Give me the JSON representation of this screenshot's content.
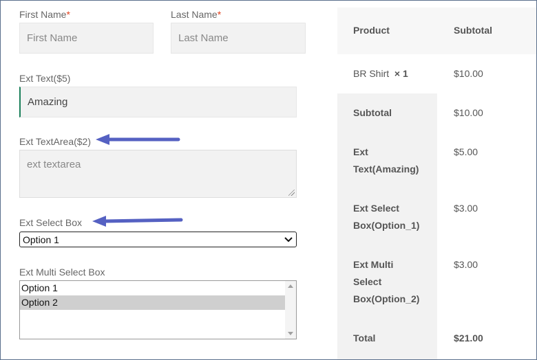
{
  "form": {
    "first_name": {
      "label": "First Name",
      "required_mark": "*",
      "placeholder": "First Name"
    },
    "last_name": {
      "label": "Last Name",
      "required_mark": "*",
      "placeholder": "Last Name"
    },
    "ext_text": {
      "label": "Ext Text($5)",
      "value": "Amazing"
    },
    "ext_textarea": {
      "label": "Ext TextArea($2)",
      "placeholder": "ext textarea"
    },
    "ext_select": {
      "label": "Ext Select Box",
      "value": "Option 1"
    },
    "ext_multi": {
      "label": "Ext Multi Select Box",
      "options": [
        {
          "label": "Option 1",
          "selected": false
        },
        {
          "label": "Option 2",
          "selected": true
        }
      ]
    }
  },
  "order_summary": {
    "header": {
      "product": "Product",
      "subtotal": "Subtotal"
    },
    "item": {
      "name": "BR Shirt",
      "qty": "× 1",
      "price": "$10.00"
    },
    "rows": [
      {
        "label": "Subtotal",
        "value": "$10.00"
      },
      {
        "label_lines": [
          "Ext",
          "Text(Amazing)"
        ],
        "value": "$5.00"
      },
      {
        "label_lines": [
          "Ext Select",
          "Box(Option_1)"
        ],
        "value": "$3.00"
      },
      {
        "label_lines": [
          "Ext Multi",
          "Select",
          "Box(Option_2)"
        ],
        "value": "$3.00"
      }
    ],
    "total": {
      "label": "Total",
      "value": "$21.00"
    }
  },
  "colors": {
    "arrow": "#5561c2",
    "required": "#e2401c",
    "focus_border": "#1a7f5a"
  }
}
